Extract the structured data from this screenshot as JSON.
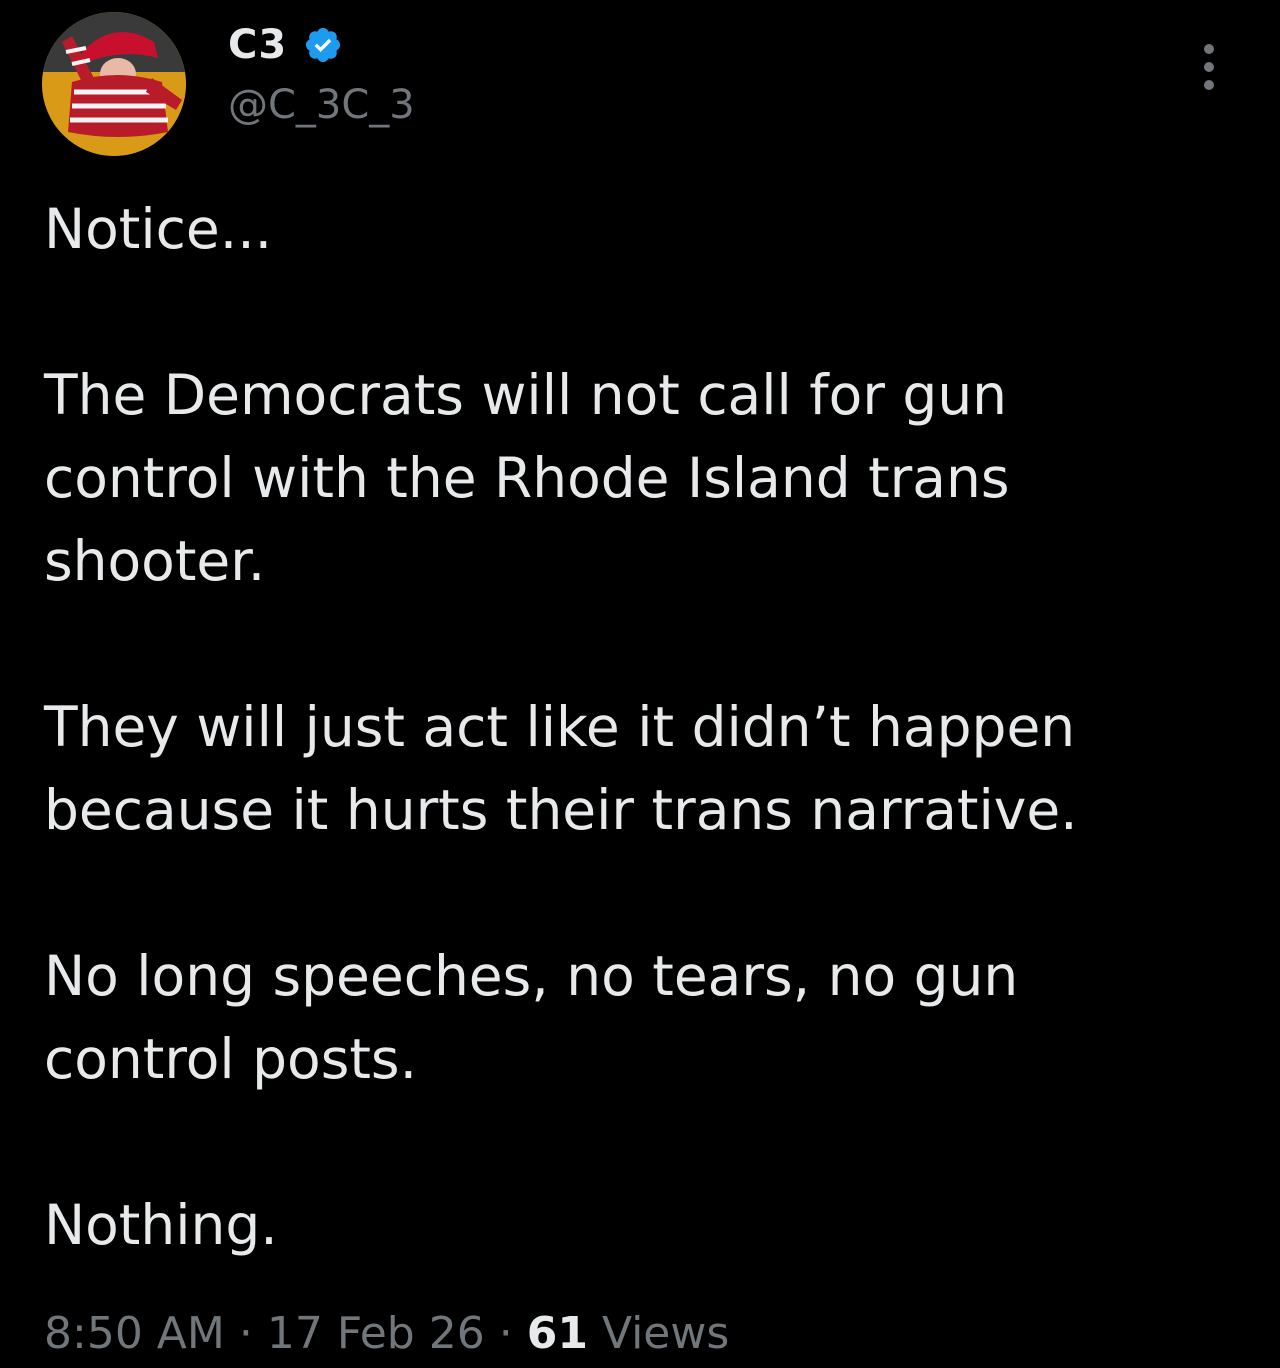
{
  "user": {
    "display_name": "C3",
    "handle": "@C_3C_3",
    "verified_color": "#1d9bf0"
  },
  "icons": {
    "verified": "verified-badge-icon",
    "more": "more-options-icon"
  },
  "tweet": {
    "paragraphs": [
      "Notice...",
      "The Democrats will not call for gun control with the Rhode Island trans shooter.",
      "They will just act like it didn’t happen because it hurts their trans narrative.",
      "No long speeches, no tears, no gun control posts.",
      "Nothing."
    ],
    "time": "8:50 AM",
    "separator": "·",
    "date": "17 Feb 26",
    "views_count": "61",
    "views_label": "Views"
  },
  "colors": {
    "background": "#000000",
    "text_primary": "#e7e9ea",
    "text_secondary": "#71767b"
  }
}
